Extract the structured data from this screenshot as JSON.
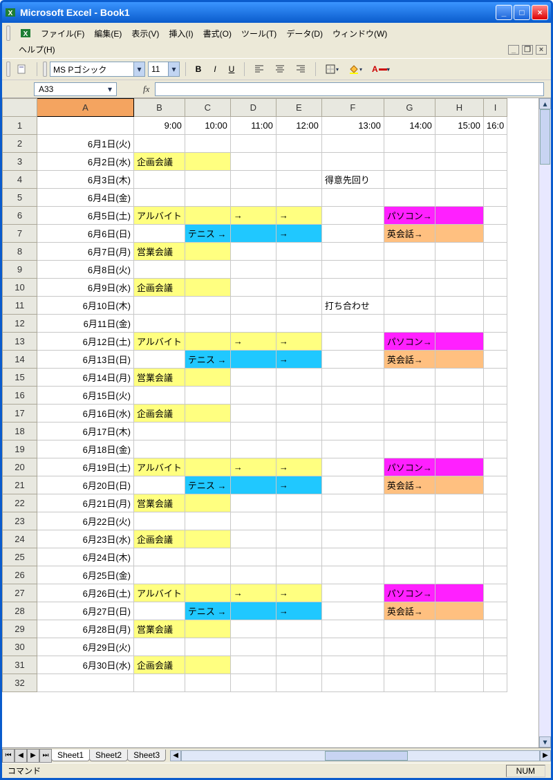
{
  "title": "Microsoft Excel - Book1",
  "menus": {
    "file": "ファイル(F)",
    "edit": "編集(E)",
    "view": "表示(V)",
    "insert": "挿入(I)",
    "format": "書式(O)",
    "tools": "ツール(T)",
    "data": "データ(D)",
    "window": "ウィンドウ(W)",
    "help": "ヘルプ(H)"
  },
  "toolbar": {
    "font": "MS Pゴシック",
    "size": "11"
  },
  "namebox": "A33",
  "columns": [
    "",
    "A",
    "B",
    "C",
    "D",
    "E",
    "F",
    "G",
    "H",
    "I"
  ],
  "header_times": {
    "B": "9:00",
    "C": "10:00",
    "D": "11:00",
    "E": "12:00",
    "F": "13:00",
    "G": "14:00",
    "H": "15:00",
    "I": "16:0"
  },
  "rows": [
    {
      "n": 1,
      "A": "",
      "B": "9:00",
      "C": "10:00",
      "D": "11:00",
      "E": "12:00",
      "F": "13:00",
      "G": "14:00",
      "H": "15:00",
      "I": "16:0"
    },
    {
      "n": 2,
      "A": "6月1日(火)"
    },
    {
      "n": 3,
      "A": "6月2日(水)",
      "B": {
        "t": "企画会議",
        "cls": "bg-yel"
      },
      "C": {
        "t": "",
        "cls": "bg-yel"
      }
    },
    {
      "n": 4,
      "A": "6月3日(木)",
      "F": {
        "t": "得意先回り",
        "cls": "c-red"
      }
    },
    {
      "n": 5,
      "A": "6月4日(金)"
    },
    {
      "n": 6,
      "A": {
        "t": "6月5日(土)",
        "cls": "c-sat"
      },
      "B": {
        "t": "アルバイト",
        "cls": "bg-yel"
      },
      "C": {
        "t": "",
        "cls": "bg-yel"
      },
      "D": {
        "t": "→",
        "cls": "bg-yel"
      },
      "E": {
        "t": "→",
        "cls": "bg-yel"
      },
      "G": {
        "t": "パソコン→",
        "cls": "bg-mag"
      },
      "H": {
        "t": "",
        "cls": "bg-mag"
      }
    },
    {
      "n": 7,
      "A": {
        "t": "6月6日(日)",
        "cls": "c-sun"
      },
      "C": {
        "t": "テニス →",
        "cls": "bg-cyan"
      },
      "D": {
        "t": "",
        "cls": "bg-cyan"
      },
      "E": {
        "t": "→",
        "cls": "bg-cyan"
      },
      "G": {
        "t": "英会話→",
        "cls": "bg-org"
      },
      "H": {
        "t": "",
        "cls": "bg-org"
      }
    },
    {
      "n": 8,
      "A": "6月7日(月)",
      "B": {
        "t": "営業会議",
        "cls": "bg-yel"
      },
      "C": {
        "t": "",
        "cls": "bg-yel"
      }
    },
    {
      "n": 9,
      "A": "6月8日(火)"
    },
    {
      "n": 10,
      "A": "6月9日(水)",
      "B": {
        "t": "企画会議",
        "cls": "bg-yel"
      },
      "C": {
        "t": "",
        "cls": "bg-yel"
      }
    },
    {
      "n": 11,
      "A": "6月10日(木)",
      "F": {
        "t": "打ち合わせ",
        "cls": "c-red"
      }
    },
    {
      "n": 12,
      "A": "6月11日(金)"
    },
    {
      "n": 13,
      "A": {
        "t": "6月12日(土)",
        "cls": "c-sat"
      },
      "B": {
        "t": "アルバイト",
        "cls": "bg-yel"
      },
      "C": {
        "t": "",
        "cls": "bg-yel"
      },
      "D": {
        "t": "→",
        "cls": "bg-yel"
      },
      "E": {
        "t": "→",
        "cls": "bg-yel"
      },
      "G": {
        "t": "パソコン→",
        "cls": "bg-mag"
      },
      "H": {
        "t": "",
        "cls": "bg-mag"
      }
    },
    {
      "n": 14,
      "A": {
        "t": "6月13日(日)",
        "cls": "c-sun"
      },
      "C": {
        "t": "テニス →",
        "cls": "bg-cyan"
      },
      "D": {
        "t": "",
        "cls": "bg-cyan"
      },
      "E": {
        "t": "→",
        "cls": "bg-cyan"
      },
      "G": {
        "t": "英会話→",
        "cls": "bg-org"
      },
      "H": {
        "t": "",
        "cls": "bg-org"
      }
    },
    {
      "n": 15,
      "A": "6月14日(月)",
      "B": {
        "t": "営業会議",
        "cls": "bg-yel"
      },
      "C": {
        "t": "",
        "cls": "bg-yel"
      }
    },
    {
      "n": 16,
      "A": "6月15日(火)"
    },
    {
      "n": 17,
      "A": "6月16日(水)",
      "B": {
        "t": "企画会議",
        "cls": "bg-yel"
      },
      "C": {
        "t": "",
        "cls": "bg-yel"
      }
    },
    {
      "n": 18,
      "A": "6月17日(木)"
    },
    {
      "n": 19,
      "A": "6月18日(金)"
    },
    {
      "n": 20,
      "A": {
        "t": "6月19日(土)",
        "cls": "c-sat"
      },
      "B": {
        "t": "アルバイト",
        "cls": "bg-yel"
      },
      "C": {
        "t": "",
        "cls": "bg-yel"
      },
      "D": {
        "t": "→",
        "cls": "bg-yel"
      },
      "E": {
        "t": "→",
        "cls": "bg-yel"
      },
      "G": {
        "t": "パソコン→",
        "cls": "bg-mag"
      },
      "H": {
        "t": "",
        "cls": "bg-mag"
      }
    },
    {
      "n": 21,
      "A": {
        "t": "6月20日(日)",
        "cls": "c-sun"
      },
      "C": {
        "t": "テニス →",
        "cls": "bg-cyan"
      },
      "D": {
        "t": "",
        "cls": "bg-cyan"
      },
      "E": {
        "t": "→",
        "cls": "bg-cyan"
      },
      "G": {
        "t": "英会話→",
        "cls": "bg-org"
      },
      "H": {
        "t": "",
        "cls": "bg-org"
      }
    },
    {
      "n": 22,
      "A": "6月21日(月)",
      "B": {
        "t": "営業会議",
        "cls": "bg-yel"
      },
      "C": {
        "t": "",
        "cls": "bg-yel"
      }
    },
    {
      "n": 23,
      "A": "6月22日(火)"
    },
    {
      "n": 24,
      "A": "6月23日(水)",
      "B": {
        "t": "企画会議",
        "cls": "bg-yel"
      },
      "C": {
        "t": "",
        "cls": "bg-yel"
      }
    },
    {
      "n": 25,
      "A": "6月24日(木)"
    },
    {
      "n": 26,
      "A": "6月25日(金)"
    },
    {
      "n": 27,
      "A": {
        "t": "6月26日(土)",
        "cls": "c-sat"
      },
      "B": {
        "t": "アルバイト",
        "cls": "bg-yel"
      },
      "C": {
        "t": "",
        "cls": "bg-yel"
      },
      "D": {
        "t": "→",
        "cls": "bg-yel"
      },
      "E": {
        "t": "→",
        "cls": "bg-yel"
      },
      "G": {
        "t": "パソコン→",
        "cls": "bg-mag"
      },
      "H": {
        "t": "",
        "cls": "bg-mag"
      }
    },
    {
      "n": 28,
      "A": {
        "t": "6月27日(日)",
        "cls": "c-sun"
      },
      "C": {
        "t": "テニス →",
        "cls": "bg-cyan"
      },
      "D": {
        "t": "",
        "cls": "bg-cyan"
      },
      "E": {
        "t": "→",
        "cls": "bg-cyan"
      },
      "G": {
        "t": "英会話→",
        "cls": "bg-org"
      },
      "H": {
        "t": "",
        "cls": "bg-org"
      }
    },
    {
      "n": 29,
      "A": "6月28日(月)",
      "B": {
        "t": "営業会議",
        "cls": "bg-yel"
      },
      "C": {
        "t": "",
        "cls": "bg-yel"
      }
    },
    {
      "n": 30,
      "A": "6月29日(火)"
    },
    {
      "n": 31,
      "A": "6月30日(水)",
      "B": {
        "t": "企画会議",
        "cls": "bg-yel"
      },
      "C": {
        "t": "",
        "cls": "bg-yel"
      }
    },
    {
      "n": 32,
      "A": ""
    }
  ],
  "sheets": [
    "Sheet1",
    "Sheet2",
    "Sheet3"
  ],
  "status": {
    "left": "コマンド",
    "num": "NUM"
  }
}
